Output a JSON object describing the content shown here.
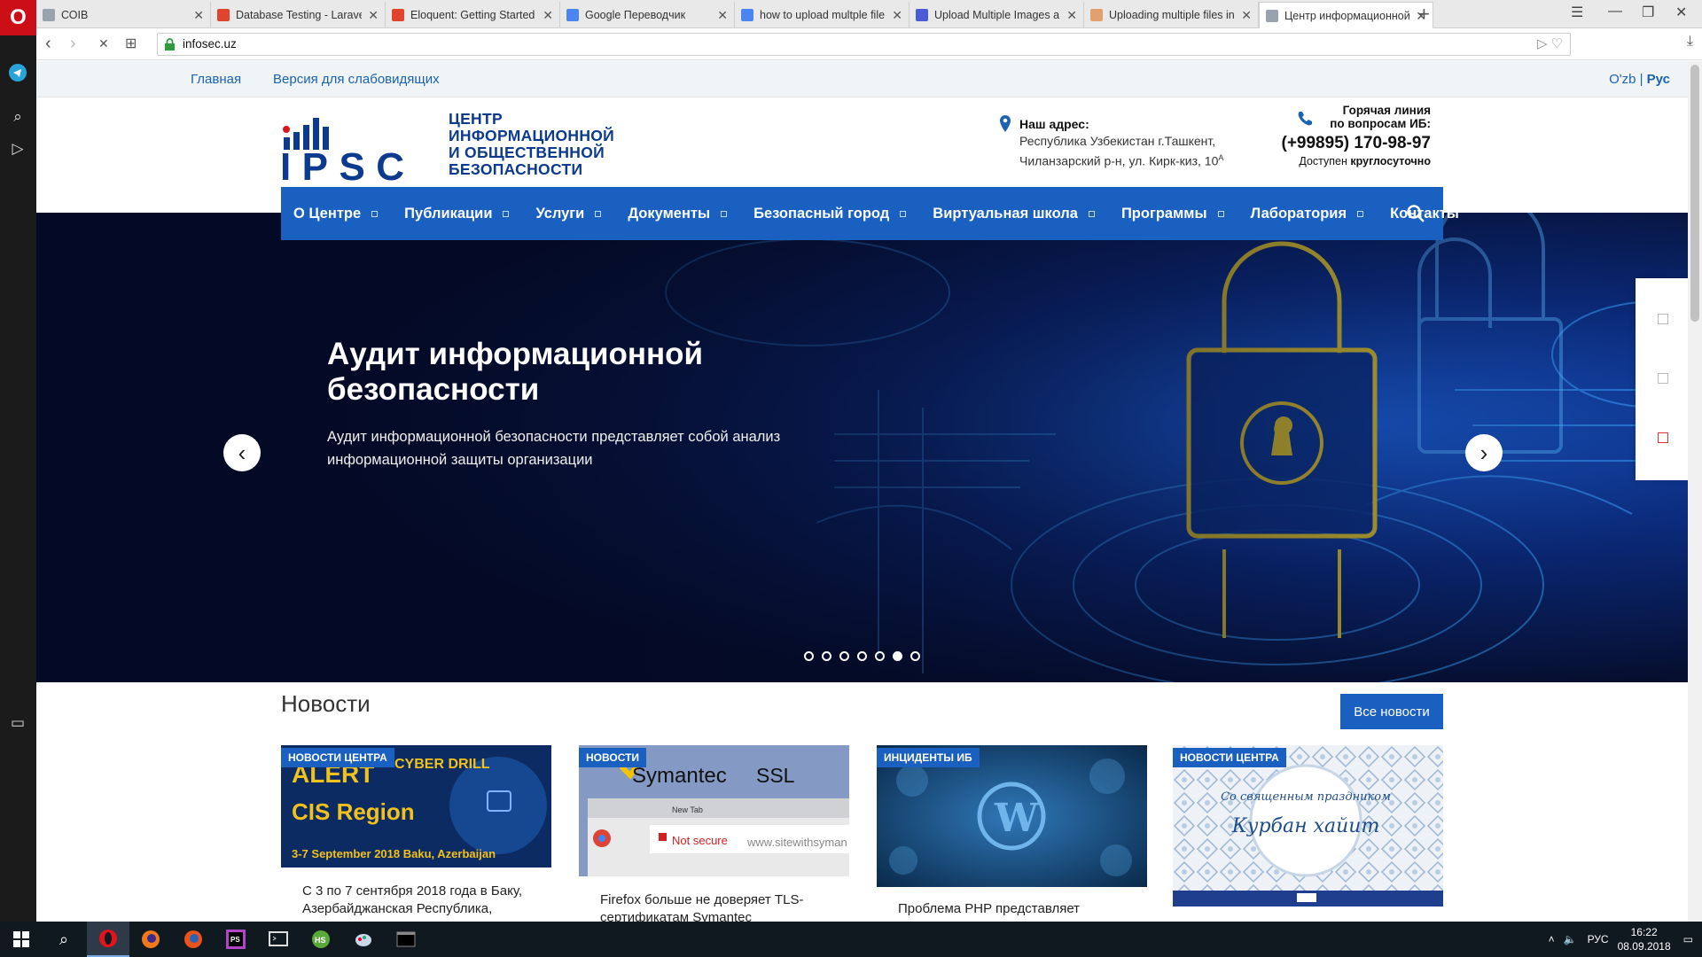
{
  "browser": {
    "logo": "O",
    "tabs": [
      {
        "title": "СОІВ",
        "favicon_color": "#9aa3ad"
      },
      {
        "title": "Database Testing - Laravel",
        "favicon_color": "#e0442f"
      },
      {
        "title": "Eloquent: Getting Started",
        "favicon_color": "#e0442f"
      },
      {
        "title": "Google Переводчик",
        "favicon_color": "#4a85f0"
      },
      {
        "title": "how to upload multple file",
        "favicon_color": "#4a85f0"
      },
      {
        "title": "Upload Multiple Images a",
        "favicon_color": "#4b5bd6"
      },
      {
        "title": "Uploading multiple files in",
        "favicon_color": "#e0a070"
      },
      {
        "title": "Центр информационной",
        "favicon_color": "#9aa3ad"
      }
    ],
    "active_tab": 7,
    "url": "infosec.uz",
    "tab_close": "✕",
    "new_tab": "+"
  },
  "site": {
    "toplinks": {
      "home": " Главная",
      "accessibility": " Версия для слабовидящих"
    },
    "lang": {
      "uz": "O'zb",
      "sep": " | ",
      "ru": "Рус"
    },
    "logo": {
      "acronym": "IPSC",
      "name_lines": [
        "ЦЕНТР",
        "ИНФОРМАЦИОННОЙ",
        "И ОБЩЕСТВЕННОЙ",
        "БЕЗОПАСНОСТИ"
      ]
    },
    "address": {
      "label": "Наш адрес:",
      "line1": "Республика Узбекистан г.Ташкент,",
      "line2": "Чиланзарский р-н, ул. Кирк-киз, 10",
      "sup": "А"
    },
    "hotline": {
      "line1": "Горячая линия",
      "line2": "по вопросам ИБ:",
      "phone": "(+99895) 170-98-97",
      "available": "Доступен ",
      "available_bold": "круглосуточно"
    },
    "nav": [
      "О Центре",
      "Публикации",
      "Услуги",
      "Документы",
      "Безопасный город",
      "Виртуальная школа",
      "Программы",
      "Лаборатория",
      "Контакты"
    ],
    "nav_has_submenu": [
      true,
      true,
      true,
      true,
      true,
      true,
      true,
      true,
      false
    ],
    "slider": {
      "title_line1": "Аудит информационной",
      "title_line2": "безопасности",
      "text_line1": "Аудит информационной безопасности представляет собой анализ",
      "text_line2": "информационной защиты организации",
      "prev": "‹",
      "next": "›",
      "slide_count": 7,
      "active_slide": 6
    },
    "news": {
      "heading": "Новости",
      "all_button": "Все новости",
      "cards": [
        {
          "tag": "НОВОСТИ ЦЕНТРА",
          "img_text1": "ALERT",
          "img_text2": "CYBER DRILL",
          "img_text3": "CIS Region",
          "img_text4": "3-7 September 2018  Baku, Azerbaijan",
          "caption1": "С 3 по 7 сентября 2018 года в Баку,",
          "caption2": "Азербайджанская Республика,"
        },
        {
          "tag": "НОВОСТИ",
          "img_text1": "Symantec",
          "img_text2": "SSL",
          "img_text3": "Not secure",
          "img_text4": "www.sitewithsyman",
          "img_text5": "New Tab",
          "caption1": "Firefox больше не доверяет TLS-",
          "caption2": "сертификатам Symantec"
        },
        {
          "tag": "ИНЦИДЕНТЫ ИБ",
          "caption1": "Проблема PHP представляет"
        },
        {
          "tag": "НОВОСТИ ЦЕНТРА",
          "img_text1": "Со священным праздником",
          "img_text2": "Курбан хайит"
        }
      ]
    }
  },
  "taskbar": {
    "lang": "РУС",
    "time": "16:22",
    "date": "08.09.2018"
  },
  "colors": {
    "brand_blue": "#1960c1",
    "logo_red": "#e1141c",
    "logo_navy": "#0c3a8e",
    "opera_red": "#cc0f16"
  }
}
